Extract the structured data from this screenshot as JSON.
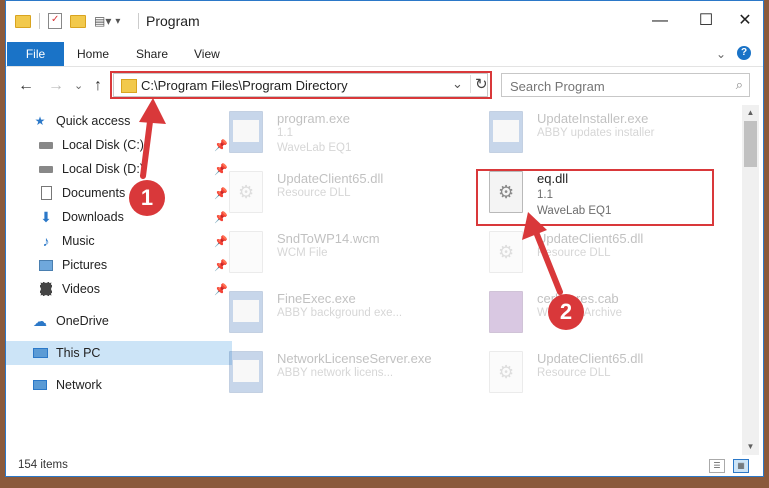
{
  "window": {
    "title": "Program",
    "controls": {
      "minimize": "—",
      "maximize": "☐",
      "close": "✕"
    }
  },
  "ribbon": {
    "file": "File",
    "home": "Home",
    "share": "Share",
    "view": "View",
    "expand": "⌄",
    "help": "?"
  },
  "address": {
    "path": "C:\\Program Files\\Program Directory",
    "dropdown": "⌄",
    "refresh": "↻"
  },
  "search": {
    "placeholder": "Search Program"
  },
  "nav": {
    "back": "←",
    "forward": "→",
    "recent": "⌄",
    "up": "↑"
  },
  "sidebar": {
    "items": [
      {
        "label": "Quick access",
        "icon": "star-icon"
      },
      {
        "label": "Local Disk (C:)",
        "icon": "drive-icon",
        "pinned": true
      },
      {
        "label": "Local Disk (D:)",
        "icon": "drive-icon",
        "pinned": true
      },
      {
        "label": "Documents",
        "icon": "documents-icon",
        "pinned": true
      },
      {
        "label": "Downloads",
        "icon": "download-icon",
        "pinned": true
      },
      {
        "label": "Music",
        "icon": "music-icon",
        "pinned": true
      },
      {
        "label": "Pictures",
        "icon": "pictures-icon",
        "pinned": true
      },
      {
        "label": "Videos",
        "icon": "videos-icon",
        "pinned": true
      },
      {
        "label": "OneDrive",
        "icon": "cloud-icon"
      },
      {
        "label": "This PC",
        "icon": "computer-icon",
        "selected": true
      },
      {
        "label": "Network",
        "icon": "network-icon"
      }
    ]
  },
  "files": [
    {
      "name": "program.exe",
      "line2": "1.1",
      "line3": "WaveLab EQ1",
      "type": "exe"
    },
    {
      "name": "UpdateInstaller.exe",
      "line2": "ABBY updates installer",
      "line3": "",
      "type": "exe"
    },
    {
      "name": "UpdateClient65.dll",
      "line2": "Resource DLL",
      "line3": "",
      "type": "dll"
    },
    {
      "name": "eq.dll",
      "line2": "1.1",
      "line3": "WaveLab EQ1",
      "type": "dll",
      "highlight": true
    },
    {
      "name": "SndToWP14.wcm",
      "line2": "WCM File",
      "line3": "",
      "type": "doc"
    },
    {
      "name": "UpdateClient65.dll",
      "line2": "Resource DLL",
      "line3": "",
      "type": "dll"
    },
    {
      "name": "FineExec.exe",
      "line2": "ABBY background exe...",
      "line3": "",
      "type": "exe"
    },
    {
      "name": "cerkeeres.cab",
      "line2": "WinRAR Archive",
      "line3": "",
      "type": "cab"
    },
    {
      "name": "NetworkLicenseServer.exe",
      "line2": "ABBY network licens...",
      "line3": "",
      "type": "exe"
    },
    {
      "name": "UpdateClient65.dll",
      "line2": "Resource DLL",
      "line3": "",
      "type": "dll"
    }
  ],
  "status": {
    "count": "154 items"
  },
  "annotations": {
    "step1": "1",
    "step2": "2",
    "color": "#d9383a"
  }
}
